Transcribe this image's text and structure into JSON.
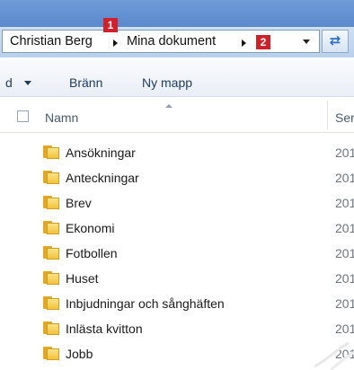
{
  "address_bar": {
    "crumbs": [
      "Christian Berg",
      "Mina dokument"
    ],
    "callouts": [
      "1",
      "2"
    ]
  },
  "toolbar": {
    "organize_label": "d",
    "burn_label": "Bränn",
    "new_folder_label": "Ny mapp"
  },
  "header": {
    "name_label": "Namn",
    "date_label": "Ser"
  },
  "files": [
    {
      "name": "Ansökningar",
      "date": "201"
    },
    {
      "name": "Anteckningar",
      "date": "201"
    },
    {
      "name": "Brev",
      "date": "201"
    },
    {
      "name": "Ekonomi",
      "date": "201"
    },
    {
      "name": "Fotbollen",
      "date": "201"
    },
    {
      "name": "Huset",
      "date": "201"
    },
    {
      "name": "Inbjudningar och sånghäften",
      "date": "201"
    },
    {
      "name": "Inlästa kvitton",
      "date": "201"
    },
    {
      "name": "Jobb",
      "date": "201"
    }
  ],
  "icons": {
    "folder": "folder-icon",
    "refresh": "refresh-icon",
    "dropdown": "chevron-down-icon"
  },
  "colors": {
    "callout": "#d0202a",
    "folder": "#f2c33c",
    "toolbar_text": "#1e3a5f"
  }
}
